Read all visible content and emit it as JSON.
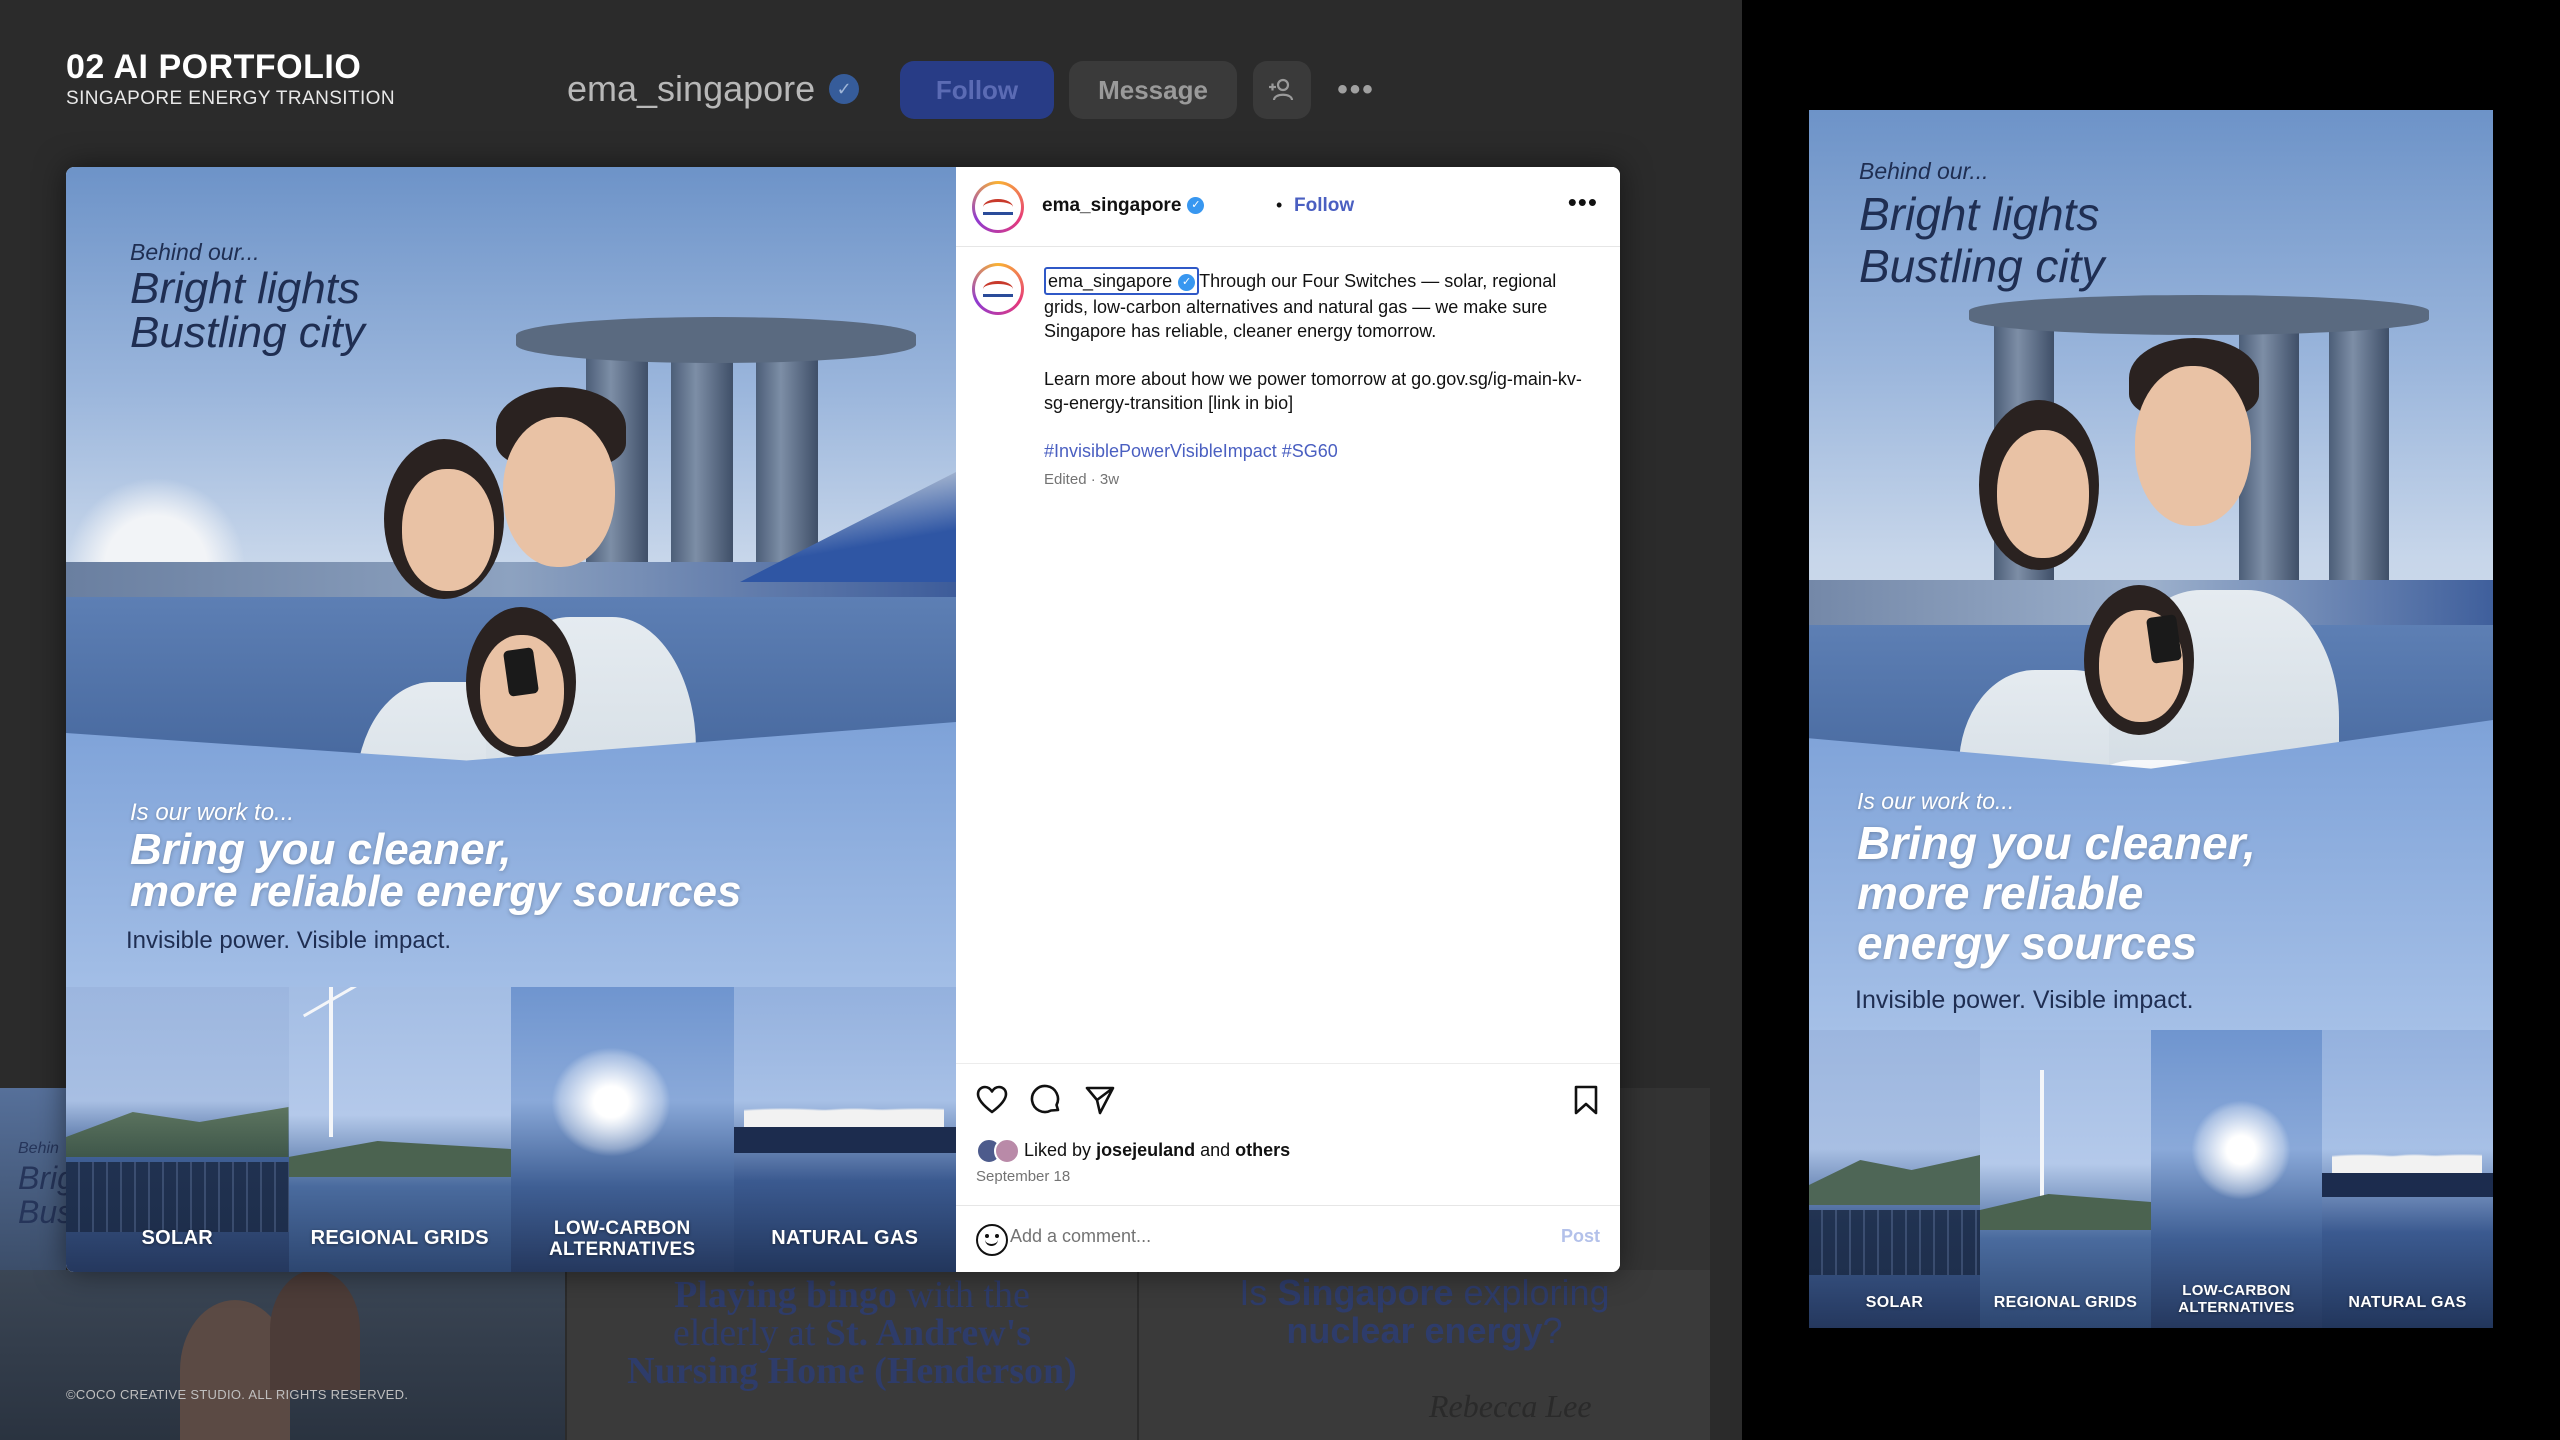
{
  "portfolio": {
    "title": "02 AI PORTFOLIO",
    "subtitle": "SINGAPORE ENERGY TRANSITION",
    "copyright": "©COCO CREATIVE STUDIO. ALL RIGHTS RESERVED."
  },
  "profile_bar": {
    "username": "ema_singapore",
    "follow_label": "Follow",
    "message_label": "Message",
    "add_user_icon": "add-user-icon",
    "more_icon": "more-icon"
  },
  "post": {
    "username": "ema_singapore",
    "separator": "•",
    "follow_label": "Follow",
    "caption_username": "ema_singapore",
    "caption_body": "Through our Four Switches — solar, regional grids, low-carbon alternatives and natural gas — we make sure Singapore has reliable, cleaner energy tomorrow.",
    "caption_link": "Learn more about how we power tomorrow at go.gov.sg/ig-main-kv-sg-energy-transition [link in bio]",
    "hashtags": "#InvisiblePowerVisibleImpact #SG60",
    "edited": "Edited · 3w",
    "liked_prefix": "Liked by",
    "liked_user": "josejeuland",
    "liked_and": "and",
    "liked_others": "others",
    "date": "September 18",
    "comment_placeholder": "Add a comment...",
    "post_label": "Post"
  },
  "poster": {
    "eyebrow_1": "Behind our...",
    "headline_1a": "Bright lights",
    "headline_1b": "Bustling city",
    "eyebrow_2": "Is our work to...",
    "headline_2a": "Bring you cleaner,",
    "headline_2b": "more reliable energy sources",
    "headline_2b_r1": "more reliable",
    "headline_2b_r2": "energy sources",
    "tagline": "Invisible power. Visible impact.",
    "switch_1": "SOLAR",
    "switch_2": "REGIONAL GRIDS",
    "switch_3a": "LOW-CARBON",
    "switch_3b": "ALTERNATIVES",
    "switch_4": "NATURAL GAS"
  },
  "background_tiles": {
    "bingo_1": "Playing bingo",
    "bingo_2": " with the",
    "bingo_3": "elderly at",
    "bingo_4": " St. Andrew's",
    "bingo_5": "Nursing Home (Henderson)",
    "nuclear_1": "Is",
    "nuclear_2": " Singapore",
    "nuclear_3": " exploring",
    "nuclear_4": "nuclear energy",
    "nuclear_5": "?",
    "signature": "Rebecca Lee",
    "strip_1": "Behin",
    "strip_2": "Brig",
    "strip_3": "Bus"
  },
  "colors": {
    "brand_blue": "#4a5fc1",
    "poster_navy": "#1f2e52",
    "verified_blue": "#3897f0"
  }
}
